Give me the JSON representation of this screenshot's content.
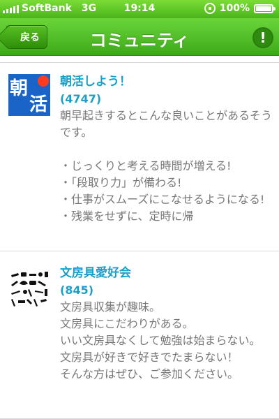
{
  "status_bar": {
    "carrier": "SoftBank",
    "network": "3G",
    "time": "19:14",
    "battery": "100%"
  },
  "nav": {
    "back_label": "戻る",
    "title": "コミュニティ",
    "alert_symbol": "!"
  },
  "communities": [
    {
      "thumb_text_1": "朝",
      "thumb_text_2": "活",
      "title": "朝活しよう！",
      "count": "",
      "description": "朝早起きするとこんな良いことがあるそうです。\n\n・じっくりと考える時間が増える!\n・「段取り力」が備わる!\n・仕事がスムーズにこなせるようになる!\n・残業をせずに、定時に帰",
      "title_count": "(4747)"
    },
    {
      "title": "文房具愛好会",
      "count": "(845)",
      "description": "文房具収集が趣味。\n文房具にこだわりがある。\nいい文房具なくして勉強は始まらない。\n文房具が好きで好きでたまらない！\nそんな方はぜひ、ご参加ください。"
    }
  ],
  "colors": {
    "green_top": "#6ad53a",
    "green_bottom": "#3da918",
    "title_blue": "#1aa0c8",
    "desc_gray": "#777777"
  }
}
